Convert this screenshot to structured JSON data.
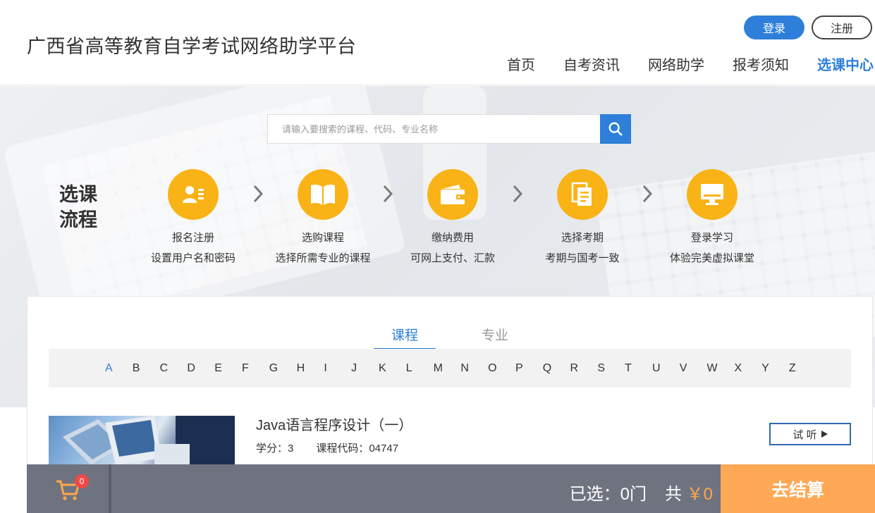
{
  "header": {
    "site_title": "广西省高等教育自学考试网络助学平台",
    "login_label": "登录",
    "register_label": "注册",
    "nav": [
      {
        "label": "首页",
        "active": false
      },
      {
        "label": "自考资讯",
        "active": false
      },
      {
        "label": "网络助学",
        "active": false
      },
      {
        "label": "报考须知",
        "active": false
      },
      {
        "label": "选课中心",
        "active": true
      }
    ]
  },
  "search": {
    "placeholder": "请输入要搜索的课程、代码、专业名称",
    "icon": "search-icon"
  },
  "flow": {
    "label_line1": "选课",
    "label_line2": "流程",
    "steps": [
      {
        "title": "报名注册",
        "desc": "设置用户名和密码",
        "icon": "user-card-icon"
      },
      {
        "title": "选购课程",
        "desc": "选择所需专业的课程",
        "icon": "book-icon"
      },
      {
        "title": "缴纳费用",
        "desc": "可网上支付、汇款",
        "icon": "wallet-icon"
      },
      {
        "title": "选择考期",
        "desc": "考期与国考一致",
        "icon": "document-icon"
      },
      {
        "title": "登录学习",
        "desc": "体验完美虚拟课堂",
        "icon": "monitor-icon"
      }
    ]
  },
  "tabs": [
    {
      "label": "课程",
      "active": true
    },
    {
      "label": "专业",
      "active": false
    }
  ],
  "alphabet": [
    "A",
    "B",
    "C",
    "D",
    "E",
    "F",
    "G",
    "H",
    "I",
    "J",
    "K",
    "L",
    "M",
    "N",
    "O",
    "P",
    "Q",
    "R",
    "S",
    "T",
    "U",
    "V",
    "W",
    "X",
    "Y",
    "Z"
  ],
  "alphabet_active": "A",
  "course": {
    "name": "Java语言程序设计（一）",
    "credit": "学分：3",
    "code": "课程代码：04747",
    "listen_label": "试 听"
  },
  "cart": {
    "badge": "0",
    "selected": "已选：0门",
    "total_prefix": "共",
    "total_price": "￥0",
    "checkout_label": "去结算"
  },
  "colors": {
    "brand_blue": "#2e7fd9",
    "step_yellow": "#f9b316",
    "checkout_orange": "#ffa856",
    "cart_bar": "#6f7380"
  }
}
